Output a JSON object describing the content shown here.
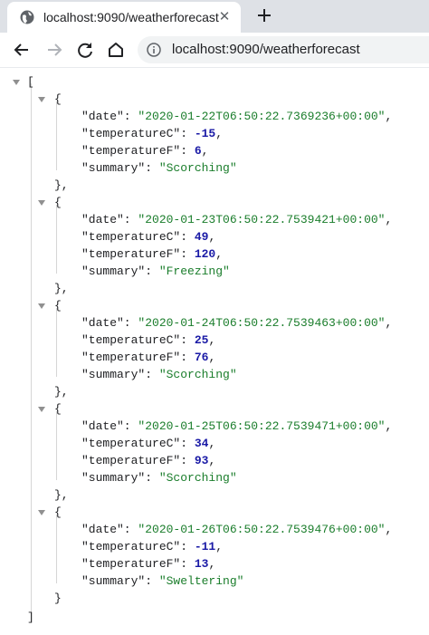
{
  "browser": {
    "tab_title": "localhost:9090/weatherforecast",
    "url": "localhost:9090/weatherforecast",
    "icons": [
      "globe-icon",
      "close-icon",
      "plus-icon",
      "back-arrow-icon",
      "forward-arrow-icon",
      "reload-icon",
      "home-icon",
      "info-icon"
    ]
  },
  "json": {
    "open_bracket": "[",
    "close_bracket": "]",
    "items": [
      {
        "date": "\"2020-01-22T06:50:22.7369236+00:00\"",
        "temperatureC": "-15",
        "temperatureF": "6",
        "summary": "\"Scorching\""
      },
      {
        "date": "\"2020-01-23T06:50:22.7539421+00:00\"",
        "temperatureC": "49",
        "temperatureF": "120",
        "summary": "\"Freezing\""
      },
      {
        "date": "\"2020-01-24T06:50:22.7539463+00:00\"",
        "temperatureC": "25",
        "temperatureF": "76",
        "summary": "\"Scorching\""
      },
      {
        "date": "\"2020-01-25T06:50:22.7539471+00:00\"",
        "temperatureC": "34",
        "temperatureF": "93",
        "summary": "\"Scorching\""
      },
      {
        "date": "\"2020-01-26T06:50:22.7539476+00:00\"",
        "temperatureC": "-11",
        "temperatureF": "13",
        "summary": "\"Sweltering\""
      }
    ],
    "keys": {
      "date": "\"date\": ",
      "temperatureC": "\"temperatureC\": ",
      "temperatureF": "\"temperatureF\": ",
      "summary": "\"summary\": "
    },
    "punct": {
      "open": "{",
      "close_comma": "},",
      "close": "}",
      "comma": ","
    }
  },
  "colors": {
    "string": "#1a7d2b",
    "number": "#1a1aa6",
    "tabstrip": "#dee1e6",
    "omnibox": "#f1f3f4"
  }
}
